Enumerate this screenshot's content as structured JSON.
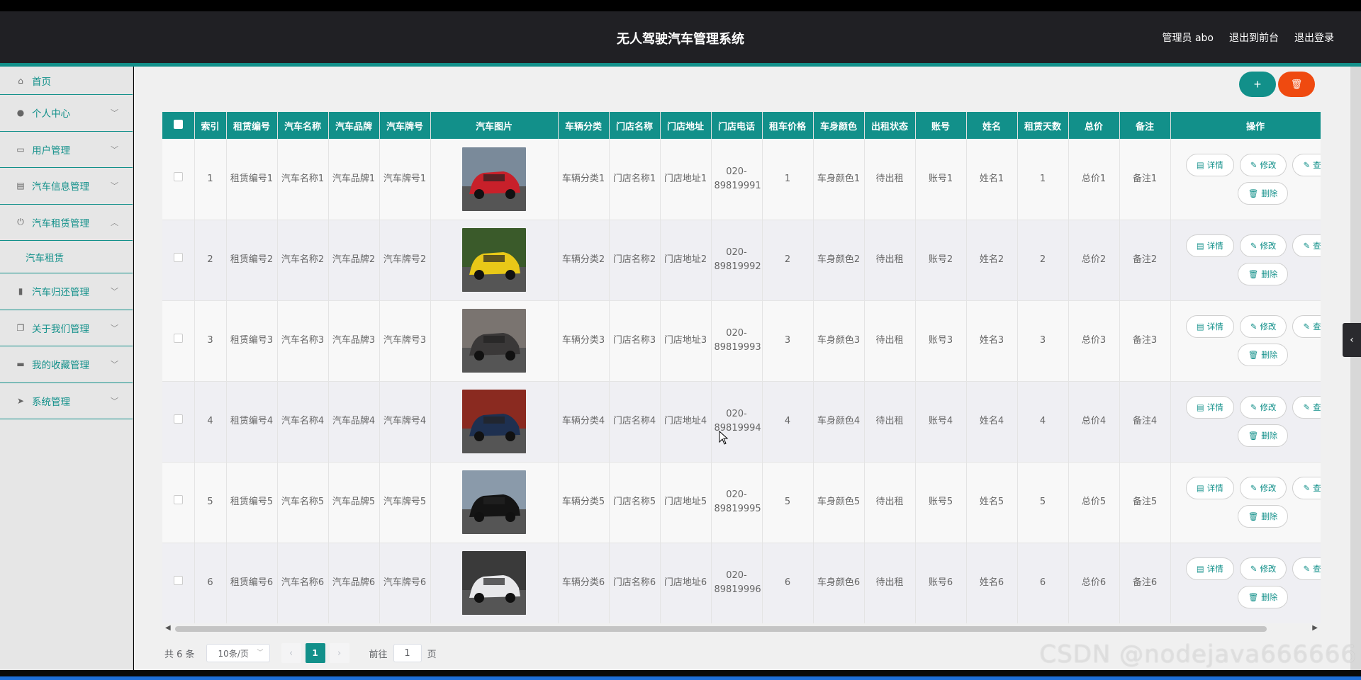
{
  "header": {
    "title": "无人驾驶汽车管理系统",
    "admin_label": "管理员 abo",
    "back_front_label": "退出到前台",
    "logout_label": "退出登录"
  },
  "sidebar": {
    "items": [
      {
        "label": "首页",
        "icon": "home-icon"
      },
      {
        "label": "个人中心",
        "icon": "user-icon"
      },
      {
        "label": "用户管理",
        "icon": "chat-icon"
      },
      {
        "label": "汽车信息管理",
        "icon": "card-icon"
      },
      {
        "label": "汽车租赁管理",
        "icon": "power-icon",
        "expanded": true,
        "sub": "汽车租赁"
      },
      {
        "label": "汽车归还管理",
        "icon": "chart-icon"
      },
      {
        "label": "关于我们管理",
        "icon": "copy-icon"
      },
      {
        "label": "我的收藏管理",
        "icon": "ticket-icon"
      },
      {
        "label": "系统管理",
        "icon": "send-icon"
      }
    ]
  },
  "toolbar": {
    "add_label": "+",
    "delete_label": "🗑"
  },
  "table": {
    "headers": [
      "索引",
      "租赁编号",
      "汽车名称",
      "汽车品牌",
      "汽车牌号",
      "汽车图片",
      "车辆分类",
      "门店名称",
      "门店地址",
      "门店电话",
      "租车价格",
      "车身颜色",
      "出租状态",
      "账号",
      "姓名",
      "租赁天数",
      "总价",
      "备注",
      "操作"
    ],
    "rows": [
      {
        "idx": "1",
        "rent_no": "租赁编号1",
        "car_name": "汽车名称1",
        "brand": "汽车品牌1",
        "plate": "汽车牌号1",
        "category": "车辆分类1",
        "store": "门店名称1",
        "address": "门店地址1",
        "phone": "020-89819991",
        "price": "1",
        "color": "车身颜色1",
        "status": "待出租",
        "account": "账号1",
        "name": "姓名1",
        "days": "1",
        "total": "总价1",
        "note": "备注1",
        "img_colors": [
          "#c8202a",
          "#7a8a9a"
        ]
      },
      {
        "idx": "2",
        "rent_no": "租赁编号2",
        "car_name": "汽车名称2",
        "brand": "汽车品牌2",
        "plate": "汽车牌号2",
        "category": "车辆分类2",
        "store": "门店名称2",
        "address": "门店地址2",
        "phone": "020-89819992",
        "price": "2",
        "color": "车身颜色2",
        "status": "待出租",
        "account": "账号2",
        "name": "姓名2",
        "days": "2",
        "total": "总价2",
        "note": "备注2",
        "img_colors": [
          "#e8c818",
          "#3a5a2a"
        ]
      },
      {
        "idx": "3",
        "rent_no": "租赁编号3",
        "car_name": "汽车名称3",
        "brand": "汽车品牌3",
        "plate": "汽车牌号3",
        "category": "车辆分类3",
        "store": "门店名称3",
        "address": "门店地址3",
        "phone": "020-89819993",
        "price": "3",
        "color": "车身颜色3",
        "status": "待出租",
        "account": "账号3",
        "name": "姓名3",
        "days": "3",
        "total": "总价3",
        "note": "备注3",
        "img_colors": [
          "#3a3838",
          "#7a7470"
        ]
      },
      {
        "idx": "4",
        "rent_no": "租赁编号4",
        "car_name": "汽车名称4",
        "brand": "汽车品牌4",
        "plate": "汽车牌号4",
        "category": "车辆分类4",
        "store": "门店名称4",
        "address": "门店地址4",
        "phone": "020-89819994",
        "price": "4",
        "color": "车身颜色4",
        "status": "待出租",
        "account": "账号4",
        "name": "姓名4",
        "days": "4",
        "total": "总价4",
        "note": "备注4",
        "img_colors": [
          "#1e3050",
          "#8a2a20"
        ]
      },
      {
        "idx": "5",
        "rent_no": "租赁编号5",
        "car_name": "汽车名称5",
        "brand": "汽车品牌5",
        "plate": "汽车牌号5",
        "category": "车辆分类5",
        "store": "门店名称5",
        "address": "门店地址5",
        "phone": "020-89819995",
        "price": "5",
        "color": "车身颜色5",
        "status": "待出租",
        "account": "账号5",
        "name": "姓名5",
        "days": "5",
        "total": "总价5",
        "note": "备注5",
        "img_colors": [
          "#141414",
          "#8a9aaa"
        ]
      },
      {
        "idx": "6",
        "rent_no": "租赁编号6",
        "car_name": "汽车名称6",
        "brand": "汽车品牌6",
        "plate": "汽车牌号6",
        "category": "车辆分类6",
        "store": "门店名称6",
        "address": "门店地址6",
        "phone": "020-89819996",
        "price": "6",
        "color": "车身颜色6",
        "status": "待出租",
        "account": "账号6",
        "name": "姓名6",
        "days": "6",
        "total": "总价6",
        "note": "备注6",
        "img_colors": [
          "#e8e8ea",
          "#3a3a3a"
        ]
      }
    ],
    "ops": {
      "detail": "详情",
      "edit": "修改",
      "view": "查看",
      "delete": "删除"
    }
  },
  "pager": {
    "total": "共 6 条",
    "page_size": "10条/页",
    "current": "1",
    "goto_label": "前往",
    "goto_value": "1",
    "page_suffix": "页"
  },
  "watermark": "CSDN @nodejava666666",
  "colors": {
    "accent": "#12908a",
    "danger": "#ef4a10",
    "header_bg": "#202024"
  }
}
